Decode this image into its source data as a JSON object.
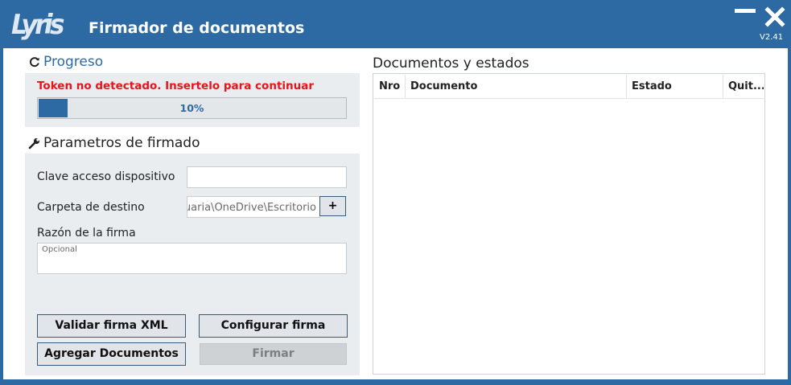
{
  "app": {
    "logo": "Lyris",
    "title": "Firmador de documentos",
    "version": "V2.41"
  },
  "progress": {
    "heading": "Progreso",
    "error": "Token no detectado. Insertelo para continuar",
    "value": 10,
    "label": "10%"
  },
  "params": {
    "heading": "Parametros de firmado",
    "clave_label": "Clave acceso dispositivo",
    "clave_value": "",
    "carpeta_label": "Carpeta de destino",
    "carpeta_value": "C:\\Users\\usuaria\\OneDrive\\Escritorio",
    "browse_label": "+",
    "razon_label": "Razón de la firma",
    "razon_placeholder": "Opcional"
  },
  "buttons": {
    "validar": "Validar firma XML",
    "configurar": "Configurar firma",
    "agregar": "Agregar Documentos",
    "firmar": "Firmar"
  },
  "documents": {
    "heading": "Documentos y estados",
    "columns": [
      "Nro",
      "Documento",
      "Estado",
      "Quit..."
    ],
    "rows": []
  }
}
